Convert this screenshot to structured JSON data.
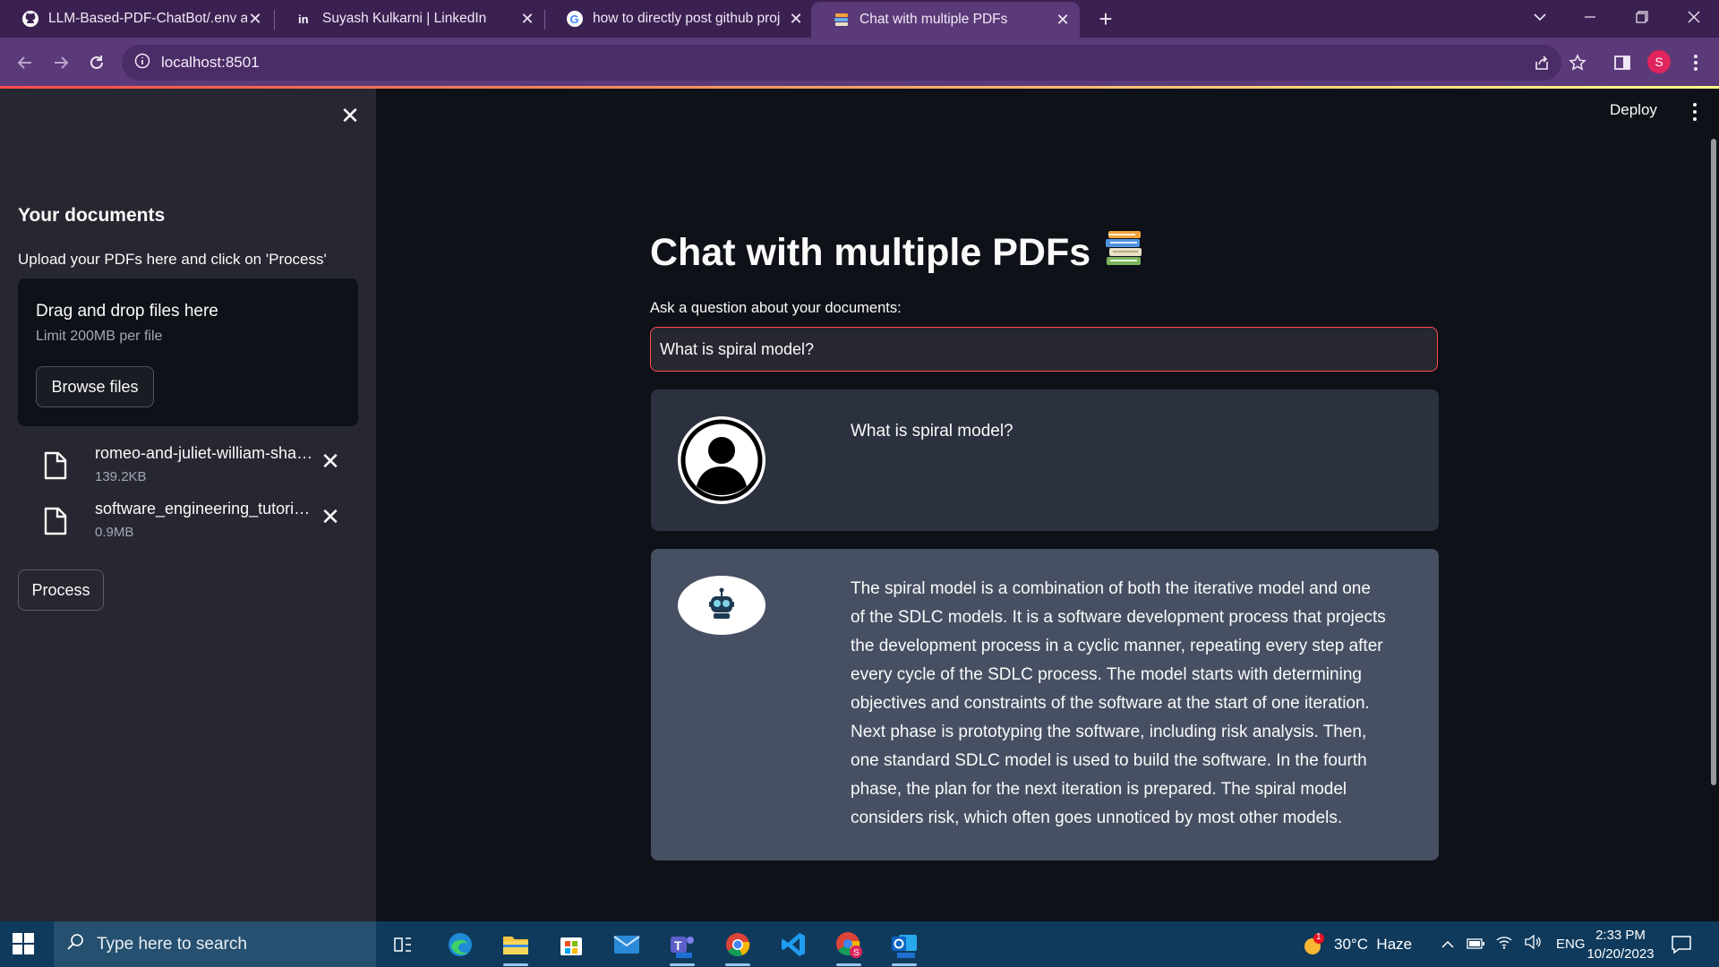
{
  "browser": {
    "tabs": [
      {
        "title": "LLM-Based-PDF-ChatBot/.env at",
        "favicon": "github-icon"
      },
      {
        "title": "Suyash Kulkarni | LinkedIn",
        "favicon": "linkedin-icon"
      },
      {
        "title": "how to directly post github proj",
        "favicon": "google-icon"
      },
      {
        "title": "Chat with multiple PDFs",
        "favicon": "books-icon"
      }
    ],
    "url": "localhost:8501",
    "profile_initial": "S"
  },
  "app": {
    "header": {
      "deploy_label": "Deploy"
    },
    "sidebar": {
      "heading": "Your documents",
      "uploader_label": "Upload your PDFs here and click on 'Process'",
      "dropzone_title": "Drag and drop files here",
      "dropzone_limit": "Limit 200MB per file",
      "browse_label": "Browse files",
      "files": [
        {
          "name": "romeo-and-juliet-william-shakespeare.pdf",
          "size": "139.2KB"
        },
        {
          "name": "software_engineering_tutorial.pdf",
          "size": "0.9MB"
        }
      ],
      "process_label": "Process"
    },
    "main": {
      "title": "Chat with multiple PDFs",
      "title_emoji": "books",
      "question_label": "Ask a question about your documents:",
      "question_value": "What is spiral model?",
      "messages": [
        {
          "role": "user",
          "avatar": "user-avatar-icon",
          "text": "What is spiral model?"
        },
        {
          "role": "bot",
          "avatar": "robot-avatar-icon",
          "text": "The spiral model is a combination of both the iterative model and one of the SDLC models. It is a software development process that projects the development process in a cyclic manner, repeating every step after every cycle of the SDLC process. The model starts with determining objectives and constraints of the software at the start of one iteration. Next phase is prototyping the software, including risk analysis. Then, one standard SDLC model is used to build the software. In the fourth phase, the plan for the next iteration is prepared. The spiral model considers risk, which often goes unnoticed by most other models."
        }
      ]
    }
  },
  "taskbar": {
    "search_placeholder": "Type here to search",
    "weather": "30°C  Haze",
    "weather_badge": "1",
    "language": "ENG",
    "time": "2:33 PM",
    "date": "10/20/2023"
  },
  "colors": {
    "accent": "#ff4b4b",
    "sidebar_bg": "#262730",
    "main_bg": "#0e1117",
    "user_msg_bg": "#2b313e",
    "bot_msg_bg": "#475063",
    "chrome_frame": "#5b3a79"
  }
}
